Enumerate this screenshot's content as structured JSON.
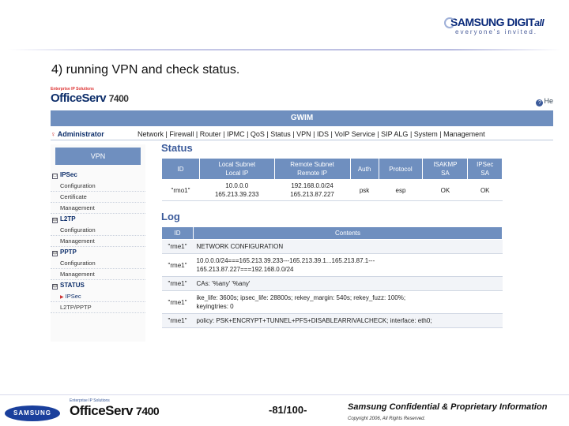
{
  "brand": {
    "name": "SAMSUNG DIGIT",
    "name_suffix": "all",
    "tagline": "everyone's invited."
  },
  "slide": {
    "title": "4) running VPN and check status."
  },
  "app": {
    "logo_small": "Enterprise IP Solutions",
    "logo_name": "OfficeServ",
    "logo_model": "7400",
    "help": "He",
    "header": "GWIM",
    "user": "Administrator",
    "nav": [
      "Network",
      "Firewall",
      "Router",
      "IPMC",
      "QoS",
      "Status",
      "VPN",
      "IDS",
      "VoIP Service",
      "SIP ALG",
      "System",
      "Management"
    ]
  },
  "sidebar": {
    "title": "VPN",
    "groups": [
      {
        "label": "IPSec",
        "toggle": "□",
        "items": [
          "Configuration",
          "Certificate",
          "Management"
        ]
      },
      {
        "label": "L2TP",
        "toggle": "⊟",
        "items": [
          "Configuration",
          "Management"
        ]
      },
      {
        "label": "PPTP",
        "toggle": "⊟",
        "items": [
          "Configuration",
          "Management"
        ]
      },
      {
        "label": "STATUS",
        "toggle": "⊟",
        "items": [
          "IPSec",
          "L2TP/PPTP"
        ]
      }
    ]
  },
  "status": {
    "title": "Status",
    "headers": [
      "ID",
      "Local Subnet\nLocal IP",
      "Remote Subnet\nRemote IP",
      "Auth",
      "Protocol",
      "ISAKMP\nSA",
      "IPSec\nSA"
    ],
    "rows": [
      [
        "\"rmo1\"",
        "10.0.0.0\n165.213.39.233",
        "192.168.0.0/24\n165.213.87.227",
        "psk",
        "esp",
        "OK",
        "OK"
      ]
    ]
  },
  "log": {
    "title": "Log",
    "headers": [
      "ID",
      "Contents"
    ],
    "rows": [
      [
        "\"rme1\"",
        "NETWORK CONFIGURATION"
      ],
      [
        "\"rme1\"",
        "10.0.0.0/24===165.213.39.233---165.213.39.1...165.213.87.1---\n165.213.87.227===192.168.0.0/24"
      ],
      [
        "\"rme1\"",
        "CAs: '%any' '%any'"
      ],
      [
        "\"rme1\"",
        "ike_life: 3600s; ipsec_life: 28800s; rekey_margin: 540s; rekey_fuzz: 100%;\nkeyingtries: 0"
      ],
      [
        "\"rme1\"",
        "policy: PSK+ENCRYPT+TUNNEL+PFS+DISABLEARRIVALCHECK; interface: eth0;"
      ]
    ]
  },
  "footer": {
    "samsung": "SAMSUNG",
    "os_small": "Enterprise IP Solutions",
    "os_name": "OfficeServ",
    "os_model": "7400",
    "page": "-81/100-",
    "confidential": "Samsung Confidential & Proprietary Information",
    "copyright": "Copyright 2006, All Rights Reserved."
  }
}
